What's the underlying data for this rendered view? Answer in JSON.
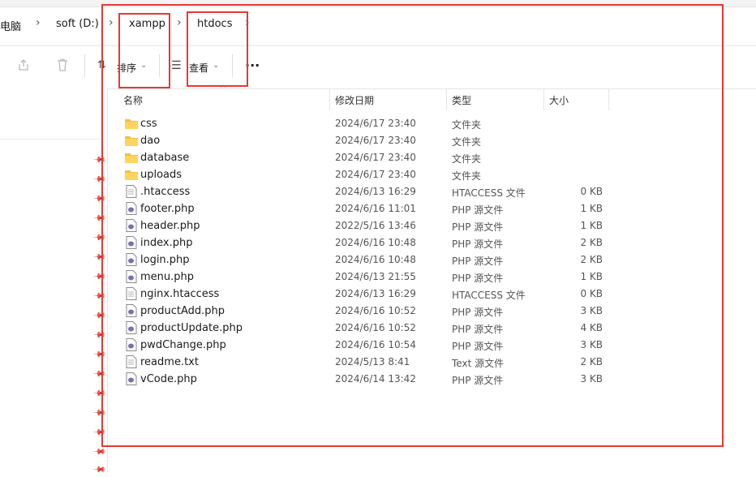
{
  "breadcrumb": {
    "items": [
      "电脑",
      "soft (D:)",
      "xampp",
      "htdocs"
    ]
  },
  "toolbar": {
    "sort_label": "排序",
    "view_label": "查看",
    "more_label": "···"
  },
  "columns": {
    "name": "名称",
    "date": "修改日期",
    "type": "类型",
    "size": "大小"
  },
  "files": [
    {
      "name": "css",
      "date": "2024/6/17 23:40",
      "type": "文件夹",
      "size": "",
      "icon": "folder-icon"
    },
    {
      "name": "dao",
      "date": "2024/6/17 23:40",
      "type": "文件夹",
      "size": "",
      "icon": "folder-icon"
    },
    {
      "name": "database",
      "date": "2024/6/17 23:40",
      "type": "文件夹",
      "size": "",
      "icon": "folder-icon"
    },
    {
      "name": "uploads",
      "date": "2024/6/17 23:40",
      "type": "文件夹",
      "size": "",
      "icon": "folder-icon"
    },
    {
      "name": ".htaccess",
      "date": "2024/6/13 16:29",
      "type": "HTACCESS 文件",
      "size": "0 KB",
      "icon": "text-file-icon"
    },
    {
      "name": "footer.php",
      "date": "2024/6/16 11:01",
      "type": "PHP 源文件",
      "size": "1 KB",
      "icon": "php-file-icon"
    },
    {
      "name": "header.php",
      "date": "2022/5/16 13:46",
      "type": "PHP 源文件",
      "size": "1 KB",
      "icon": "php-file-icon"
    },
    {
      "name": "index.php",
      "date": "2024/6/16 10:48",
      "type": "PHP 源文件",
      "size": "2 KB",
      "icon": "php-file-icon"
    },
    {
      "name": "login.php",
      "date": "2024/6/16 10:48",
      "type": "PHP 源文件",
      "size": "2 KB",
      "icon": "php-file-icon"
    },
    {
      "name": "menu.php",
      "date": "2024/6/13 21:55",
      "type": "PHP 源文件",
      "size": "1 KB",
      "icon": "php-file-icon"
    },
    {
      "name": "nginx.htaccess",
      "date": "2024/6/13 16:29",
      "type": "HTACCESS 文件",
      "size": "0 KB",
      "icon": "text-file-icon"
    },
    {
      "name": "productAdd.php",
      "date": "2024/6/16 10:52",
      "type": "PHP 源文件",
      "size": "3 KB",
      "icon": "php-file-icon"
    },
    {
      "name": "productUpdate.php",
      "date": "2024/6/16 10:52",
      "type": "PHP 源文件",
      "size": "4 KB",
      "icon": "php-file-icon"
    },
    {
      "name": "pwdChange.php",
      "date": "2024/6/16 10:54",
      "type": "PHP 源文件",
      "size": "3 KB",
      "icon": "php-file-icon"
    },
    {
      "name": "readme.txt",
      "date": "2024/5/13 8:41",
      "type": "Text 源文件",
      "size": "2 KB",
      "icon": "text-file-icon"
    },
    {
      "name": "vCode.php",
      "date": "2024/6/14 13:42",
      "type": "PHP 源文件",
      "size": "3 KB",
      "icon": "php-file-icon"
    }
  ],
  "colors": {
    "annotation": "#e53935",
    "folder": "#f4c040",
    "php_icon": "#7a6fb0"
  }
}
